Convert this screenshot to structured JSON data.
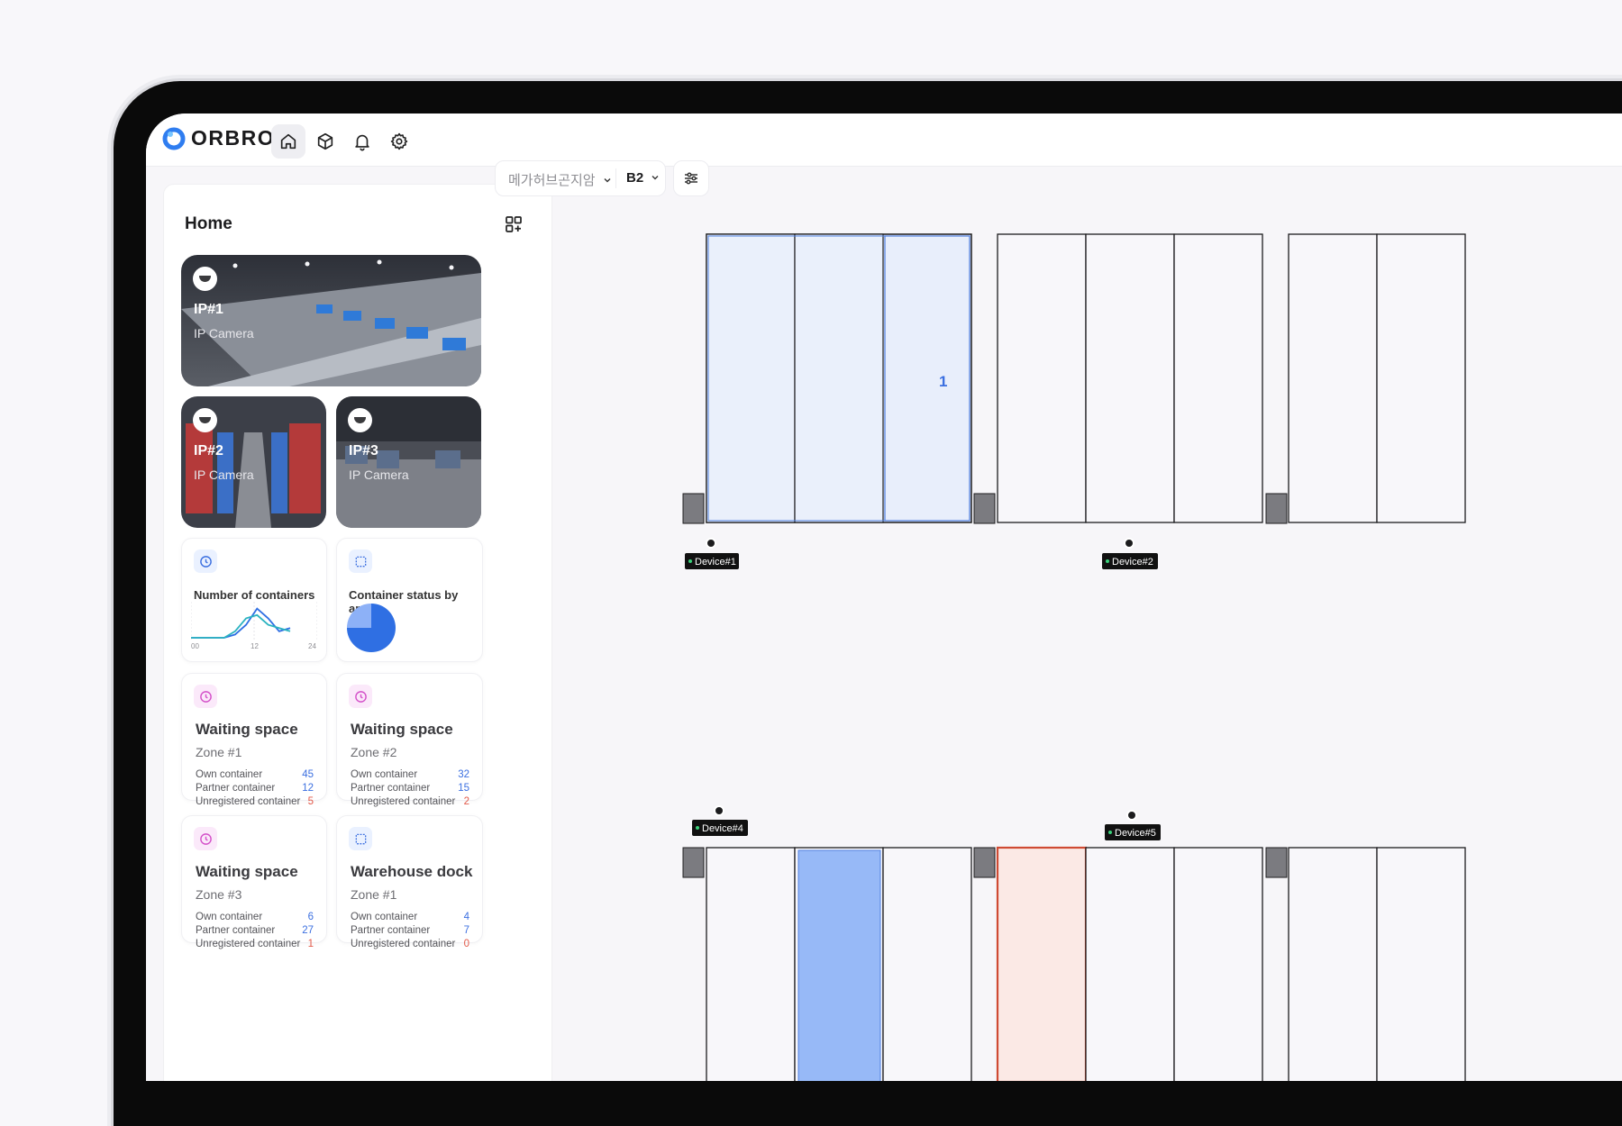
{
  "app": {
    "brand": "ORBRO"
  },
  "nav": [
    {
      "name": "home-icon",
      "active": true
    },
    {
      "name": "box-icon",
      "active": false
    },
    {
      "name": "bell-icon",
      "active": false
    },
    {
      "name": "gear-icon",
      "active": false
    }
  ],
  "home": {
    "title": "Home"
  },
  "cameras": [
    {
      "title": "IP#1",
      "subtitle": "IP Camera"
    },
    {
      "title": "IP#2",
      "subtitle": "IP Camera"
    },
    {
      "title": "IP#3",
      "subtitle": "IP Camera"
    }
  ],
  "widgets": {
    "containers": {
      "title": "Number of containers",
      "ticks": [
        "00",
        "12",
        "24"
      ],
      "series": [
        {
          "name": "",
          "color": "#2f6fe3",
          "values": [
            0,
            0,
            0,
            0,
            1,
            4,
            9,
            6,
            2,
            3
          ]
        },
        {
          "name": "",
          "color": "#2bb3c0",
          "values": [
            0,
            0,
            0,
            0,
            2,
            6,
            7,
            4,
            3,
            2
          ]
        }
      ]
    },
    "status_by_area": {
      "title": "Container status by area"
    }
  },
  "chart_data": [
    {
      "type": "line",
      "title": "Number of containers",
      "xticks": [
        "00",
        "12",
        "24"
      ],
      "x": [
        0,
        2.67,
        5.33,
        8,
        10.67,
        13.33,
        16,
        18.67,
        21.33,
        24
      ],
      "series": [
        {
          "values": [
            0,
            0,
            0,
            0,
            1,
            4,
            9,
            6,
            2,
            3
          ]
        },
        {
          "values": [
            0,
            0,
            0,
            0,
            2,
            6,
            7,
            4,
            3,
            2
          ]
        }
      ]
    },
    {
      "type": "pie",
      "title": "Container status by area",
      "values": [
        25,
        75
      ],
      "colors": [
        "#8db1f7",
        "#2f6fe3"
      ]
    }
  ],
  "zones": [
    {
      "title": "Waiting space",
      "zone": "Zone #1",
      "icon": "clock-icon",
      "own": "45",
      "partner": "12",
      "unregistered": "5"
    },
    {
      "title": "Waiting space",
      "zone": "Zone #2",
      "icon": "clock-icon",
      "own": "32",
      "partner": "15",
      "unregistered": "2"
    },
    {
      "title": "Waiting space",
      "zone": "Zone #3",
      "icon": "clock-icon",
      "own": "6",
      "partner": "27",
      "unregistered": "1"
    },
    {
      "title": "Warehouse dock",
      "zone": "Zone #1",
      "icon": "area-icon",
      "own": "4",
      "partner": "7",
      "unregistered": "0"
    }
  ],
  "labels": {
    "own": "Own container",
    "partner": "Partner container",
    "unregistered": "Unregistered container"
  },
  "filters": {
    "site": "메가허브곤지암",
    "floor": "B2"
  },
  "floorplan": {
    "slot_number": "1",
    "devices": [
      "Device#1",
      "Device#2",
      "Device#4",
      "Device#5"
    ]
  }
}
